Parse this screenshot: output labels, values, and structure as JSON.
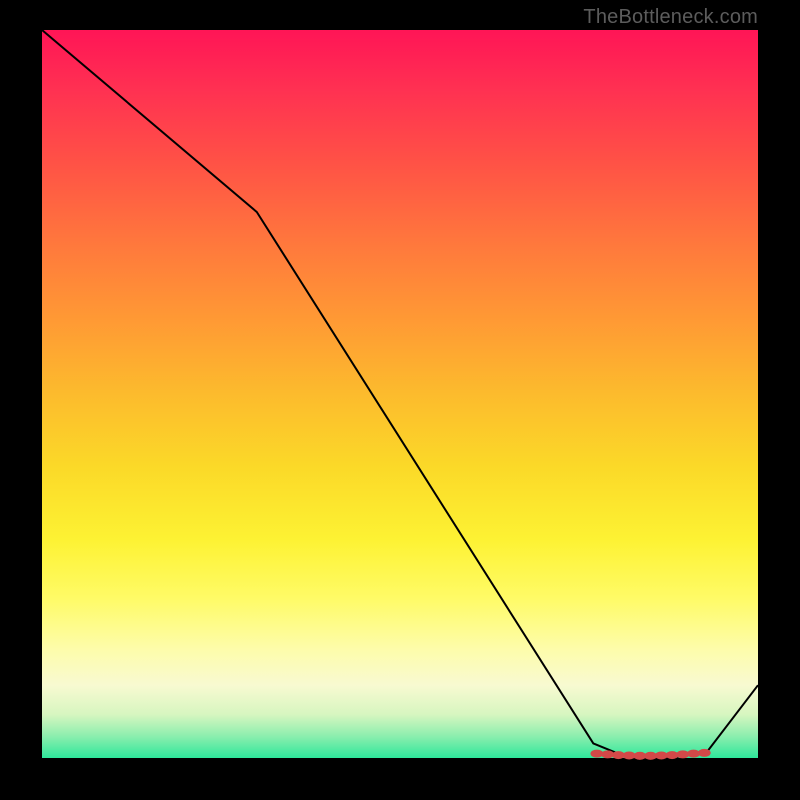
{
  "credit": "TheBottleneck.com",
  "chart_data": {
    "type": "line",
    "title": "",
    "xlabel": "",
    "ylabel": "",
    "xlim": [
      0,
      100
    ],
    "ylim": [
      0,
      100
    ],
    "grid": false,
    "legend": false,
    "series": [
      {
        "name": "curve",
        "color": "#000000",
        "x": [
          0,
          30,
          77,
          82,
          88,
          93,
          100
        ],
        "values": [
          100,
          75,
          2,
          0,
          0,
          1,
          10
        ]
      },
      {
        "name": "highlight-markers",
        "color": "#d34848",
        "marker": true,
        "x": [
          77.5,
          79,
          80.5,
          82,
          83.5,
          85,
          86.5,
          88,
          89.5,
          91,
          92.5
        ],
        "values": [
          0.6,
          0.5,
          0.4,
          0.35,
          0.3,
          0.3,
          0.35,
          0.4,
          0.5,
          0.6,
          0.7
        ]
      }
    ]
  }
}
